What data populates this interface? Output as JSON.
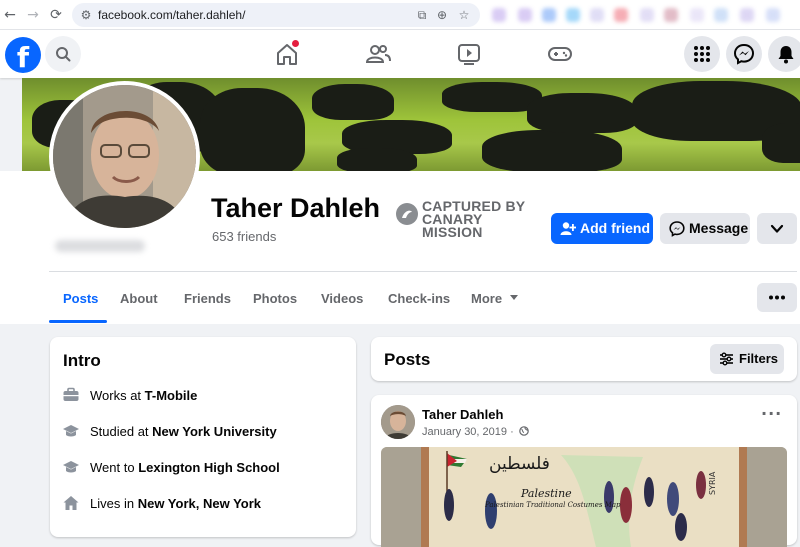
{
  "browser": {
    "back_icon": "arrow-left-icon",
    "forward_icon": "arrow-right-icon",
    "reload_icon": "reload-icon",
    "url": "facebook.com/taher.dahleh/"
  },
  "header": {
    "name": "Taher Dahleh",
    "friends": "653 friends",
    "badge_line1": "CAPTURED BY",
    "badge_line2": "CANARY MISSION",
    "add_friend_label": "Add friend",
    "message_label": "Message"
  },
  "tabs": [
    "Posts",
    "About",
    "Friends",
    "Photos",
    "Videos",
    "Check-ins",
    "More"
  ],
  "intro": {
    "title": "Intro",
    "rows": [
      {
        "prefix": "Works at ",
        "bold": "T-Mobile",
        "icon": "briefcase-icon"
      },
      {
        "prefix": "Studied at ",
        "bold": "New York University",
        "icon": "graduation-cap-icon"
      },
      {
        "prefix": "Went to ",
        "bold": "Lexington High School",
        "icon": "graduation-cap-icon"
      },
      {
        "prefix": "Lives in ",
        "bold": "New York, New York",
        "icon": "home-icon"
      }
    ]
  },
  "posts": {
    "title": "Posts",
    "filters_label": "Filters",
    "post": {
      "author": "Taher Dahleh",
      "date": "January 30, 2019 ·",
      "image_text_arabic": "فلسطين",
      "image_text_title": "Palestine",
      "image_text_sub": "Palestinian Traditional Costumes Map",
      "image_text_syria": "SYRIA"
    }
  },
  "colors": {
    "brand": "#0866ff",
    "notification_dot": "#e41e3f"
  }
}
